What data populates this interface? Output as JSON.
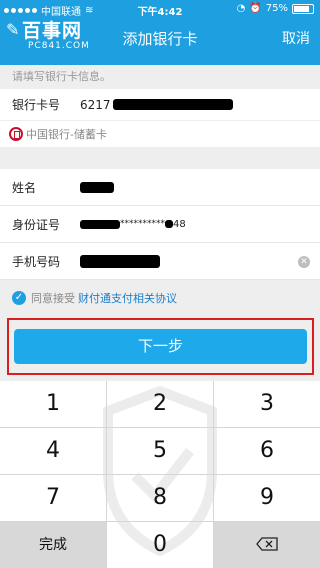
{
  "status": {
    "carrier": "中国联通",
    "time": "下午4:42",
    "battery": "75%"
  },
  "logo": {
    "title": "百事网",
    "subtitle": "PC841.COM"
  },
  "nav": {
    "title": "添加银行卡",
    "cancel": "取消"
  },
  "hint": "请填写银行卡信息。",
  "card_section": {
    "label": "银行卡号",
    "value_prefix": "6217"
  },
  "bank": {
    "name": "中国银行-储蓄卡"
  },
  "identity": {
    "name_label": "姓名",
    "id_label": "身份证号",
    "id_masked": "**********",
    "id_suffix": "48",
    "phone_label": "手机号码"
  },
  "agreement": {
    "prefix": "同意接受",
    "link": "财付通支付相关协议"
  },
  "next_button": "下一步",
  "keypad": {
    "keys": [
      "1",
      "2",
      "3",
      "4",
      "5",
      "6",
      "7",
      "8",
      "9"
    ],
    "done": "完成",
    "zero": "0",
    "delete_icon": "backspace-icon"
  },
  "colors": {
    "brand": "#1d9fe0",
    "button": "#1ea9eb",
    "highlight": "#d9201f"
  }
}
